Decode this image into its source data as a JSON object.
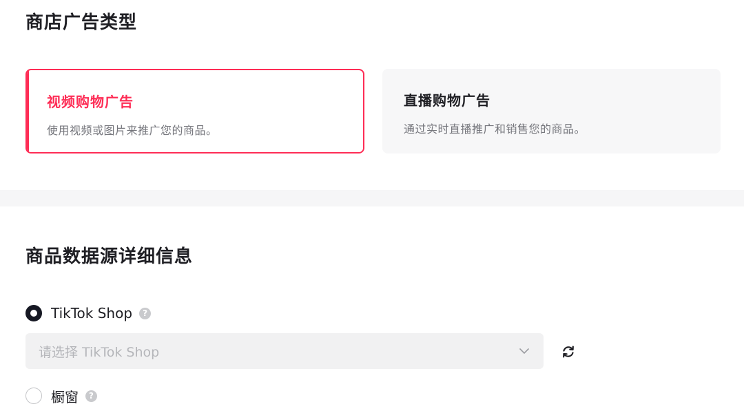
{
  "shop_ad_type": {
    "title": "商店广告类型",
    "cards": [
      {
        "title": "视频购物广告",
        "description": "使用视频或图片来推广您的商品。",
        "selected": true
      },
      {
        "title": "直播购物广告",
        "description": "通过实时直播推广和销售您的商品。",
        "selected": false
      }
    ]
  },
  "product_source": {
    "title": "商品数据源详细信息",
    "options": [
      {
        "label": "TikTok Shop",
        "checked": true,
        "help_icon": "question-circle-icon"
      },
      {
        "label": "橱窗",
        "checked": false,
        "help_icon": "question-circle-icon"
      }
    ],
    "select": {
      "placeholder": "请选择 TikTok Shop",
      "dropdown_icon": "chevron-down-icon",
      "refresh_icon": "refresh-icon"
    }
  },
  "colors": {
    "accent": "#fe2c55",
    "text": "#1f1f24",
    "muted": "#75767c",
    "placeholder": "#b5b6ba",
    "unselected_card_bg": "#f7f7f8",
    "input_bg": "#f1f1f2"
  }
}
